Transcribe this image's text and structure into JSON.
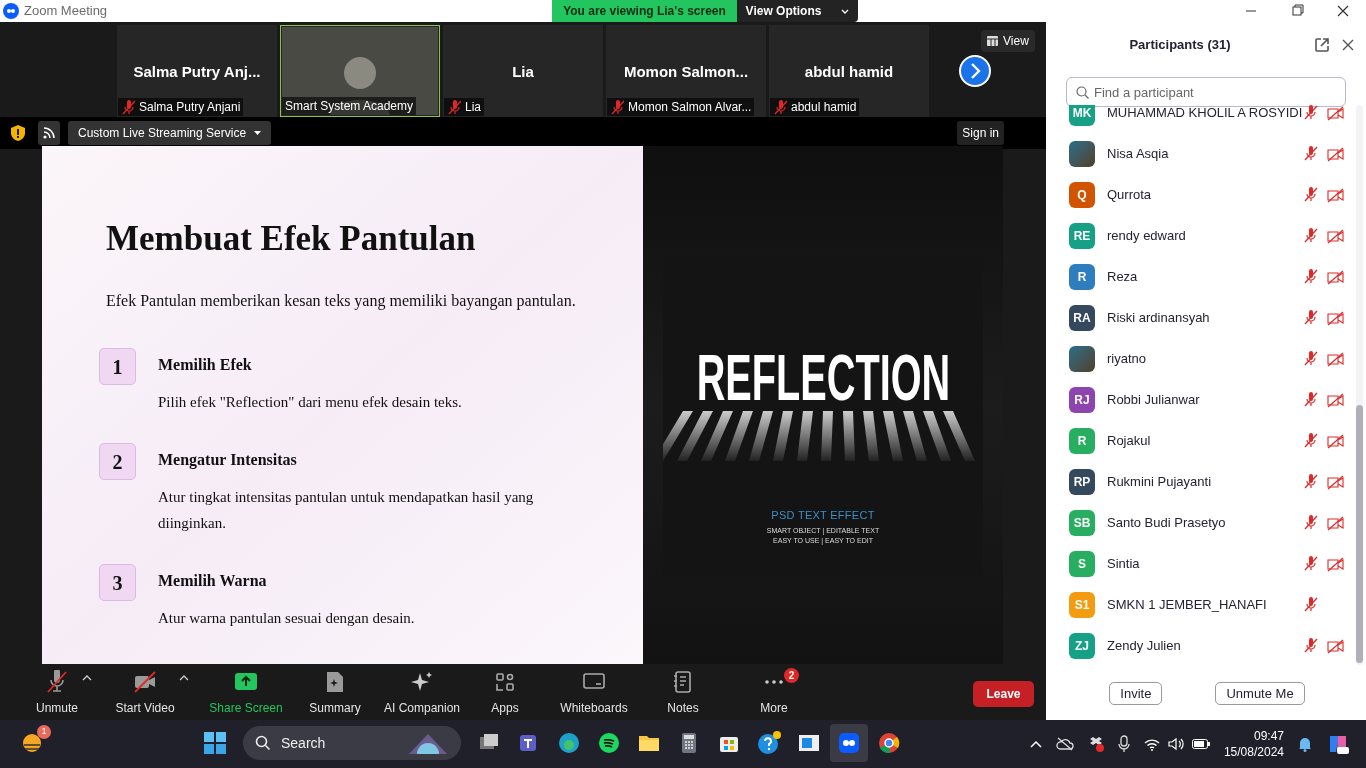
{
  "window": {
    "title": "Zoom Meeting"
  },
  "banner": {
    "text": "You are viewing Lia's screen",
    "button": "View Options"
  },
  "video_strip": {
    "tiles": [
      {
        "name": "Salma  Putry  Anj...",
        "label": "Salma Putry Anjani",
        "muted": true,
        "video": false,
        "selected": false
      },
      {
        "label": "Smart System Academy",
        "muted": false,
        "video": true,
        "selected": true
      },
      {
        "name": "Lia",
        "label": "Lia",
        "muted": true,
        "video": false,
        "selected": false
      },
      {
        "name": "Momon  Salmon...",
        "label": "Momon Salmon Alvar...",
        "muted": true,
        "video": false,
        "selected": false
      },
      {
        "name": "abdul hamid",
        "label": "abdul hamid",
        "muted": true,
        "video": false,
        "selected": false
      }
    ],
    "view_button": "View"
  },
  "share_bar": {
    "stream_dropdown": "Custom Live Streaming Service",
    "sign_in": "Sign in"
  },
  "slide": {
    "title": "Membuat Efek Pantulan",
    "intro": "Efek Pantulan memberikan kesan teks yang memiliki bayangan pantulan.",
    "steps": [
      {
        "number": "1",
        "heading": "Memilih Efek",
        "text": "Pilih efek \"Reflection\" dari menu efek desain teks."
      },
      {
        "number": "2",
        "heading": "Mengatur Intensitas",
        "text": "Atur tingkat intensitas pantulan untuk mendapatkan hasil yang diinginkan."
      },
      {
        "number": "3",
        "heading": "Memilih Warna",
        "text": "Atur warna pantulan sesuai dengan desain."
      }
    ],
    "image": {
      "headline": "REFLECTION",
      "subtitle": "PSD TEXT EFFECT",
      "line_1": "SMART OBJECT | EDITABLE TEXT",
      "line_2": "EASY TO USE | EASY TO EDIT"
    }
  },
  "toolbar": {
    "items": [
      {
        "kind": "mic",
        "label": "Unmute",
        "caret": true
      },
      {
        "kind": "video",
        "label": "Start Video",
        "caret": true
      },
      {
        "kind": "share",
        "label": "Share Screen",
        "caret": false
      },
      {
        "kind": "summary",
        "label": "Summary",
        "caret": false
      },
      {
        "kind": "ai",
        "label": "AI Companion",
        "caret": false
      },
      {
        "kind": "apps",
        "label": "Apps",
        "caret": false
      },
      {
        "kind": "whiteboard",
        "label": "Whiteboards",
        "caret": false
      },
      {
        "kind": "notes",
        "label": "Notes",
        "caret": false
      },
      {
        "kind": "more",
        "label": "More",
        "caret": false,
        "badge": "2"
      }
    ],
    "leave": "Leave"
  },
  "participants": {
    "title": "Participants (31)",
    "search": {
      "placeholder": "Find a participant"
    },
    "items": [
      {
        "kind": "initials",
        "initials": "MK",
        "color": "#16a085",
        "name": "MUHAMMAD KHOLIL A ROSYIDI",
        "mic_muted": true,
        "video_off": true
      },
      {
        "kind": "photo",
        "name": "Nisa Asqia",
        "mic_muted": true,
        "video_off": true
      },
      {
        "kind": "initials",
        "initials": "Q",
        "color": "#d35400",
        "name": "Qurrota",
        "mic_muted": true,
        "video_off": true
      },
      {
        "kind": "initials",
        "initials": "RE",
        "color": "#16a085",
        "name": "rendy edward",
        "mic_muted": true,
        "video_off": true
      },
      {
        "kind": "initials",
        "initials": "R",
        "color": "#2e7dbf",
        "name": "Reza",
        "mic_muted": true,
        "video_off": true
      },
      {
        "kind": "initials",
        "initials": "RA",
        "color": "#34495e",
        "name": "Riski ardinansyah",
        "mic_muted": true,
        "video_off": true
      },
      {
        "kind": "photo",
        "name": "riyatno",
        "mic_muted": true,
        "video_off": true
      },
      {
        "kind": "initials",
        "initials": "RJ",
        "color": "#8e44ad",
        "name": "Robbi Julianwar",
        "mic_muted": true,
        "video_off": true
      },
      {
        "kind": "initials",
        "initials": "R",
        "color": "#27ae60",
        "name": "Rojakul",
        "mic_muted": true,
        "video_off": true
      },
      {
        "kind": "initials",
        "initials": "RP",
        "color": "#34495e",
        "name": "Rukmini Pujayanti",
        "mic_muted": true,
        "video_off": true
      },
      {
        "kind": "initials",
        "initials": "SB",
        "color": "#27ae60",
        "name": "Santo Budi Prasetyo",
        "mic_muted": true,
        "video_off": true
      },
      {
        "kind": "initials",
        "initials": "S",
        "color": "#27ae60",
        "name": "Sintia",
        "mic_muted": true,
        "video_off": true
      },
      {
        "kind": "initials",
        "initials": "S1",
        "color": "#f39c12",
        "name": "SMKN 1 JEMBER_HANAFI",
        "mic_muted": true,
        "video_off": false
      },
      {
        "kind": "initials",
        "initials": "ZJ",
        "color": "#16a085",
        "name": "Zendy Julien",
        "mic_muted": true,
        "video_off": true
      }
    ],
    "buttons": [
      "Invite",
      "Unmute Me"
    ]
  },
  "taskbar": {
    "weather_badge": "1",
    "search": "Search",
    "time": "09:47",
    "date": "15/08/2024"
  }
}
